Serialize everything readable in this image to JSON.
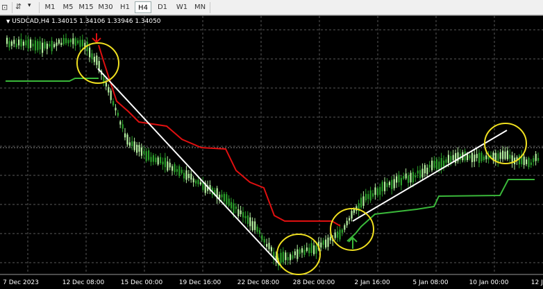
{
  "toolbar": {
    "timeframes": [
      "M1",
      "M5",
      "M15",
      "M30",
      "H1",
      "H4",
      "D1",
      "W1",
      "MN"
    ],
    "active": "H4"
  },
  "chart": {
    "symbol": "USDCAD,H4",
    "ohlc": "1.34015 1.34106 1.33946 1.34050",
    "symbol_line": "USDCAD,H4  1.34015 1.34106 1.33946 1.34050",
    "x_ticks": [
      "7 Dec 2023",
      "12 Dec 08:00",
      "15 Dec 00:00",
      "19 Dec 16:00",
      "22 Dec 08:00",
      "28 Dec 00:00",
      "2 Jan 16:00",
      "5 Jan 08:00",
      "10 Jan 00:00",
      "12 Ja"
    ]
  },
  "colors": {
    "bull_candle": "#b4f0a0",
    "bear_candle": "#2aa02a",
    "down_trail": "#e01010",
    "up_trail": "#3ab83a",
    "circle": "#f0e020",
    "trendline": "#ffffff"
  },
  "icons": [
    "crosshair-icon",
    "line-tool-icon",
    "dropdown-arrow-icon"
  ]
}
